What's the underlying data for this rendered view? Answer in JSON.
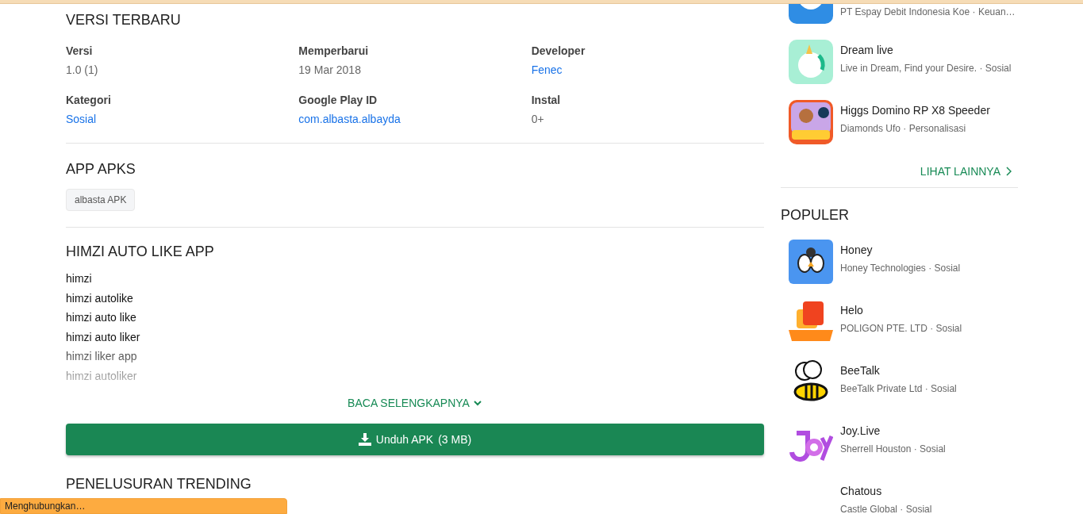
{
  "latest_version": {
    "title": "VERSI TERBARU",
    "fields": [
      {
        "label": "Versi",
        "value": "1.0 (1)",
        "link": false
      },
      {
        "label": "Memperbarui",
        "value": "19 Mar 2018",
        "link": false
      },
      {
        "label": "Developer",
        "value": "Fenec",
        "link": true
      },
      {
        "label": "Kategori",
        "value": "Sosial",
        "link": true
      },
      {
        "label": "Google Play ID",
        "value": "com.albasta.albayda",
        "link": true
      },
      {
        "label": "Instal",
        "value": "0+",
        "link": false
      }
    ]
  },
  "app_apks": {
    "title": "APP APKS",
    "tags": [
      "albasta APK"
    ]
  },
  "description": {
    "title": "HIMZI AUTO LIKE APP",
    "lines": [
      "himzi",
      "himzi autolike",
      "himzi auto like",
      "himzi auto liker",
      "himzi liker app",
      "himzi autoliker"
    ],
    "read_more": "BACA SELENGKAPNYA"
  },
  "download_button": {
    "label": "Unduh APK",
    "size": "(3 MB)"
  },
  "trending": {
    "title": "PENELUSURAN TRENDING"
  },
  "similar_apps": {
    "items": [
      {
        "subtitle": "PT Espay Debit Indonesia Koe · Keuan…",
        "kind": "chat"
      },
      {
        "title": "Dream live",
        "subtitle": "Live in Dream, Find your Desire. · Sosial",
        "kind": "unicorn"
      },
      {
        "title": "Higgs Domino RP X8 Speeder",
        "subtitle": "Diamonds Ufo · Personalisasi",
        "kind": "game"
      }
    ],
    "more": "LIHAT LAINNYA"
  },
  "popular": {
    "title": "POPULER",
    "items": [
      {
        "title": "Honey",
        "subtitle": "Honey Technologies · Sosial",
        "kind": "bee"
      },
      {
        "title": "Helo",
        "subtitle": "POLIGON PTE. LTD · Sosial",
        "kind": "bubble"
      },
      {
        "title": "BeeTalk",
        "subtitle": "BeeTalk Private Ltd · Sosial",
        "kind": "beetalk"
      },
      {
        "title": "Joy.Live",
        "subtitle": "Sherrell Houston · Sosial",
        "kind": "joy"
      },
      {
        "title": "Chatous",
        "subtitle": "Castle Global · Sosial",
        "kind": "blank"
      }
    ]
  },
  "status_bar": {
    "text": "Menghubungkan…"
  }
}
